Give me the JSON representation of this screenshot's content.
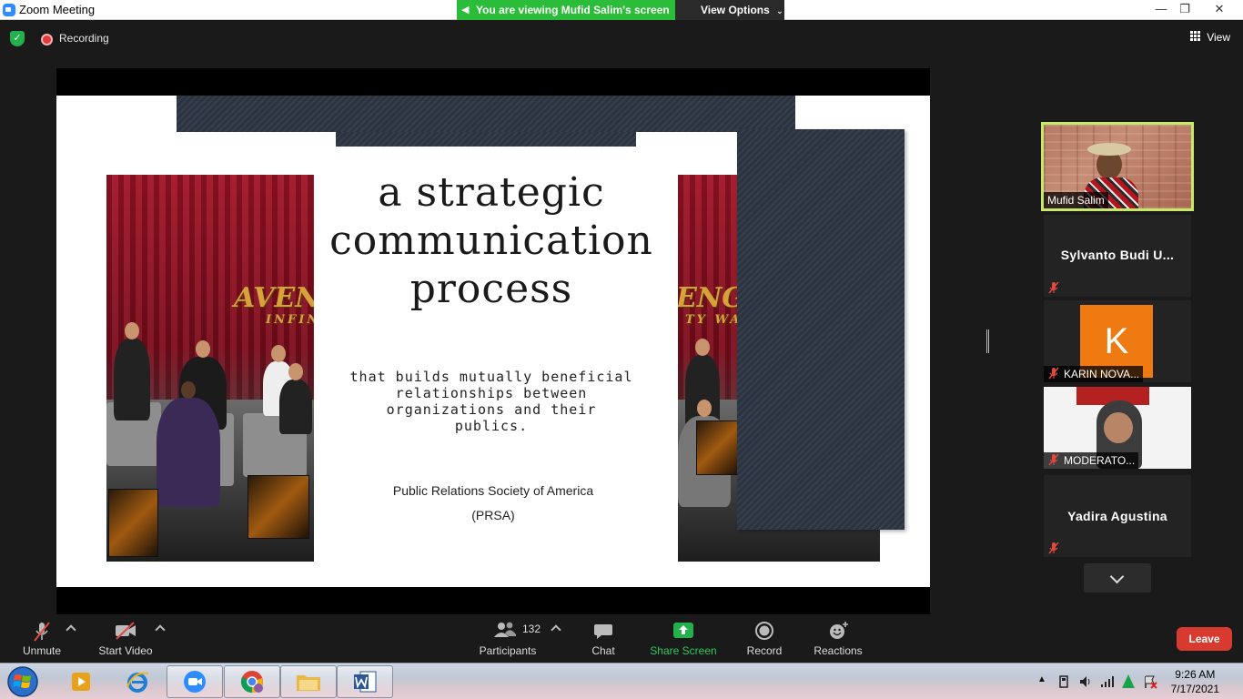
{
  "window": {
    "title": "Zoom Meeting",
    "viewing_banner": "You are viewing Mufid Salim's screen",
    "view_options": "View Options",
    "minimize": "—",
    "restore": "❐",
    "close": "✕"
  },
  "top_bar": {
    "recording_label": "Recording",
    "view_label": "View"
  },
  "slide": {
    "title_line1": "a strategic",
    "title_line2": "communication",
    "title_line3": "process",
    "subtitle_line1": "that builds mutually beneficial",
    "subtitle_line2": "relationships between",
    "subtitle_line3": "organizations and their",
    "subtitle_line4": "publics.",
    "source_line1": "Public Relations Society of America",
    "source_line2": "(PRSA)",
    "photo_left_logo": "AVENGERS",
    "photo_left_logo_sub": "INFINITY",
    "photo_right_logo": "ENGERS",
    "photo_right_logo_sub": "TY WAR",
    "theme_band_color": "#2b3340",
    "curtain_color": "#a01326"
  },
  "participants_panel": {
    "tiles": [
      {
        "name": "Mufid Salim",
        "type": "video",
        "active_speaker": true,
        "muted": false
      },
      {
        "name": "Sylvanto Budi U...",
        "type": "name",
        "muted": true
      },
      {
        "name": "KARIN NOVA...",
        "type": "avatar",
        "avatar_letter": "K",
        "avatar_color": "#f07a12",
        "muted": true
      },
      {
        "name": "MODERATO...",
        "type": "video",
        "muted": true
      },
      {
        "name": "Yadira Agustina",
        "type": "name",
        "muted": true
      }
    ],
    "active_speaker_border_color": "#c6e96a"
  },
  "toolbar": {
    "unmute": "Unmute",
    "start_video": "Start Video",
    "participants": "Participants",
    "participants_count": "132",
    "chat": "Chat",
    "share_screen": "Share Screen",
    "record": "Record",
    "reactions": "Reactions",
    "leave": "Leave",
    "share_color": "#23b14d",
    "leave_color": "#d73b2f"
  },
  "taskbar": {
    "apps": [
      "start-orb",
      "media-player",
      "internet-explorer",
      "zoom",
      "chrome",
      "file-explorer",
      "word"
    ],
    "time": "9:26 AM",
    "date": "7/17/2021"
  }
}
